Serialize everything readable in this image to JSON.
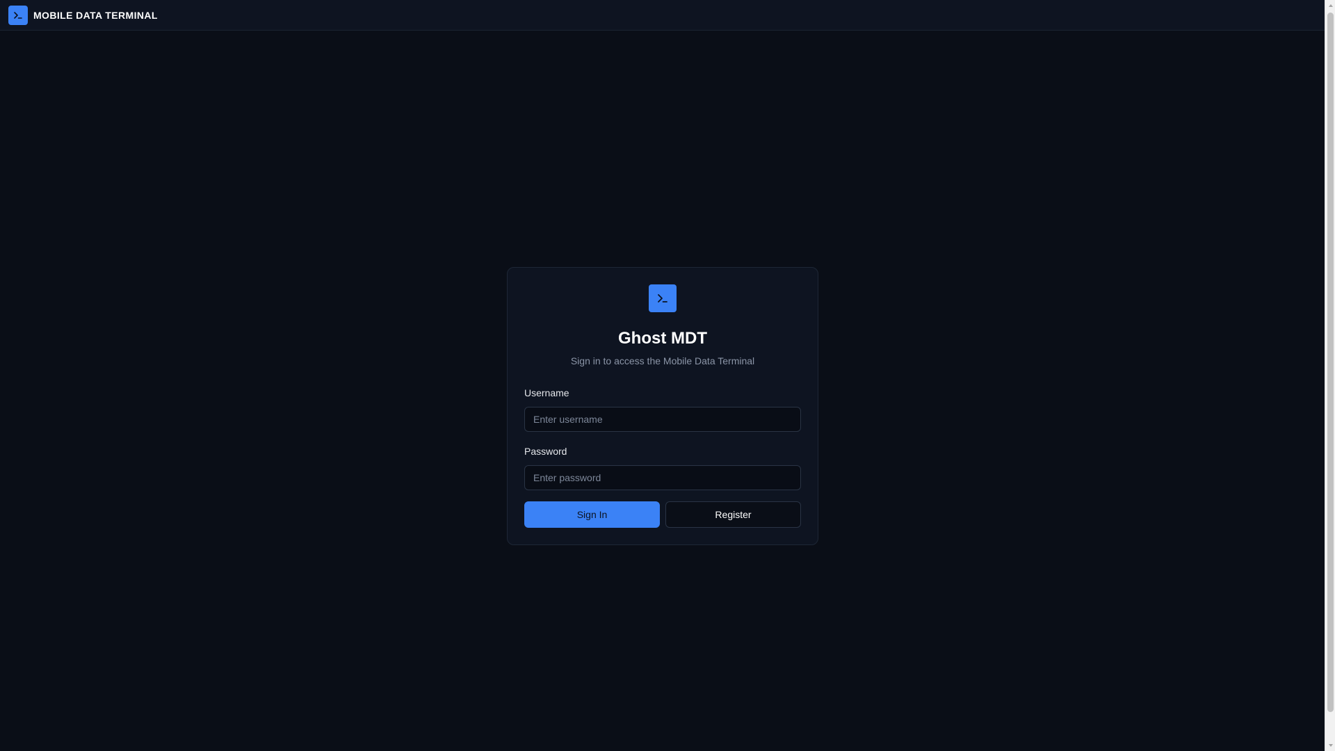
{
  "header": {
    "brand": "MOBILE DATA TERMINAL",
    "logo_icon": "terminal-icon"
  },
  "login": {
    "icon": "terminal-icon",
    "title": "Ghost MDT",
    "subtitle": "Sign in to access the Mobile Data Terminal",
    "username": {
      "label": "Username",
      "placeholder": "Enter username",
      "value": ""
    },
    "password": {
      "label": "Password",
      "placeholder": "Enter password",
      "value": ""
    },
    "sign_in_label": "Sign In",
    "register_label": "Register"
  },
  "colors": {
    "accent": "#3b82f6",
    "background": "#0a0e17",
    "surface": "#0e1421"
  }
}
